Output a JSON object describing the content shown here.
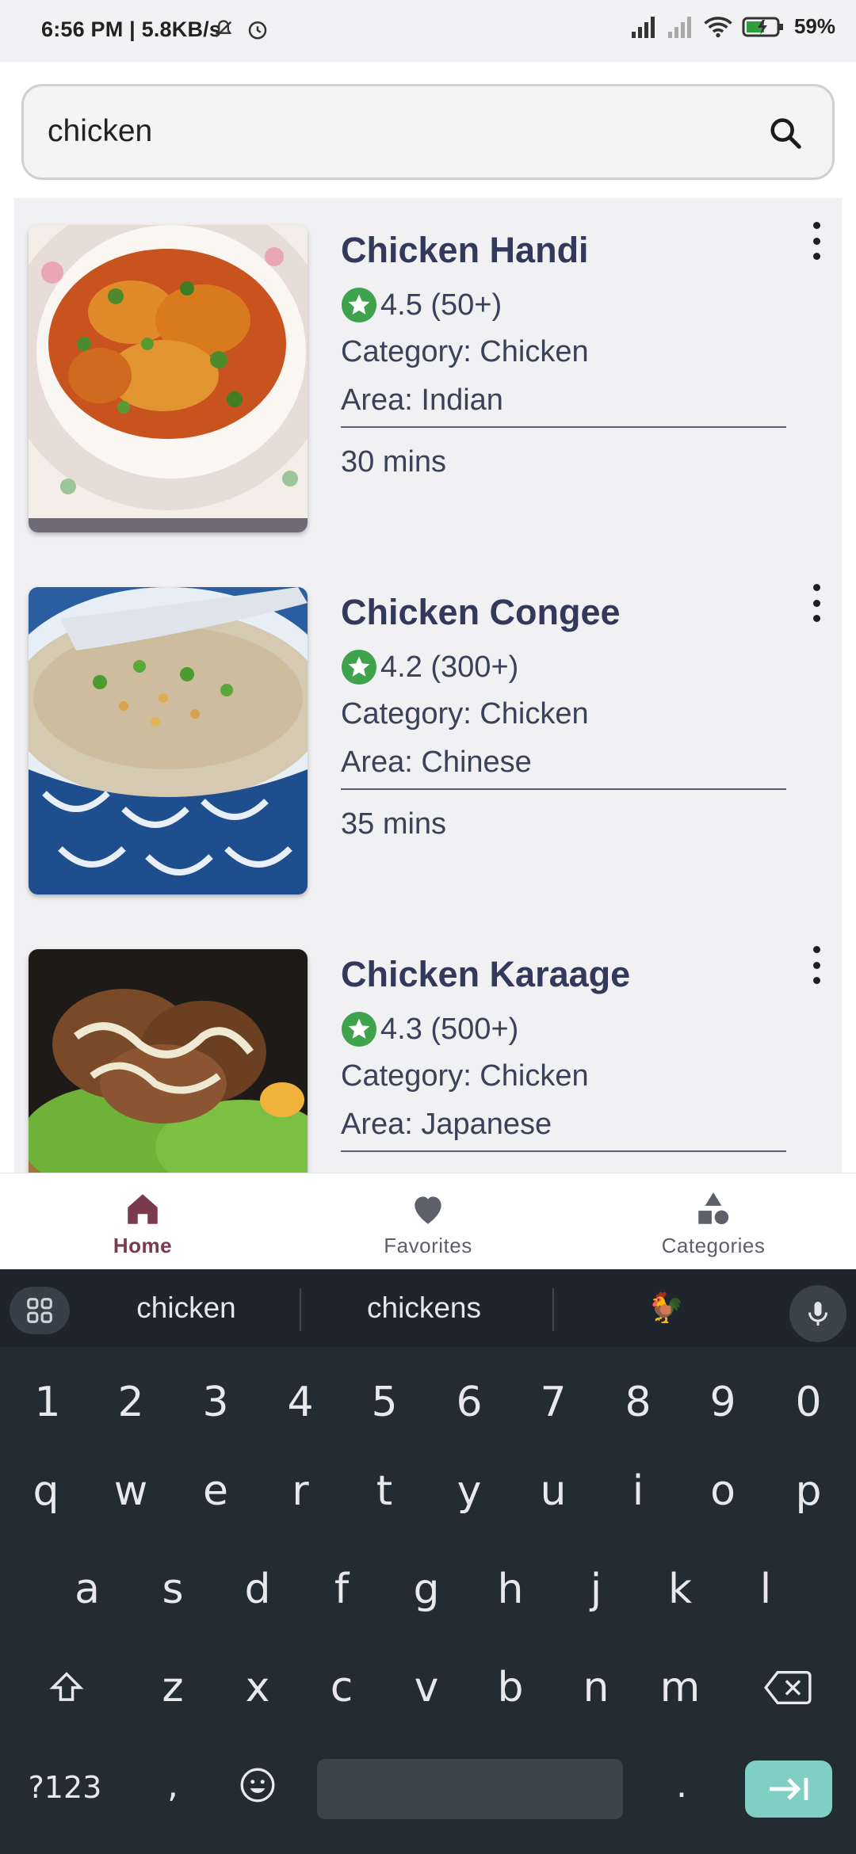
{
  "status_bar": {
    "time": "6:56 PM",
    "speed": "5.8KB/s",
    "battery": "59%"
  },
  "search": {
    "value": "chicken",
    "placeholder": ""
  },
  "recipes": [
    {
      "title": "Chicken Handi",
      "rating": "4.5 (50+)",
      "category": "Category: Chicken",
      "area": "Area: Indian",
      "time": "30 mins"
    },
    {
      "title": "Chicken Congee",
      "rating": "4.2 (300+)",
      "category": "Category: Chicken",
      "area": "Area: Chinese",
      "time": "35 mins"
    },
    {
      "title": "Chicken Karaage",
      "rating": "4.3 (500+)",
      "category": "Category: Chicken",
      "area": "Area: Japanese",
      "time": ""
    }
  ],
  "nav": {
    "home": "Home",
    "favorites": "Favorites",
    "categories": "Categories"
  },
  "keyboard": {
    "suggestions": [
      "chicken",
      "chickens",
      "🐓"
    ],
    "numbers": [
      "1",
      "2",
      "3",
      "4",
      "5",
      "6",
      "7",
      "8",
      "9",
      "0"
    ],
    "row1": [
      "q",
      "w",
      "e",
      "r",
      "t",
      "y",
      "u",
      "i",
      "o",
      "p"
    ],
    "row2": [
      "a",
      "s",
      "d",
      "f",
      "g",
      "h",
      "j",
      "k",
      "l"
    ],
    "row3": [
      "z",
      "x",
      "c",
      "v",
      "b",
      "n",
      "m"
    ],
    "symbols_key": "?123",
    "comma_key": ",",
    "period_key": "."
  },
  "colors": {
    "accent": "#7b3a4d",
    "title": "#33395a",
    "star_green": "#3fa34d",
    "enter_key": "#7fcfc5"
  }
}
